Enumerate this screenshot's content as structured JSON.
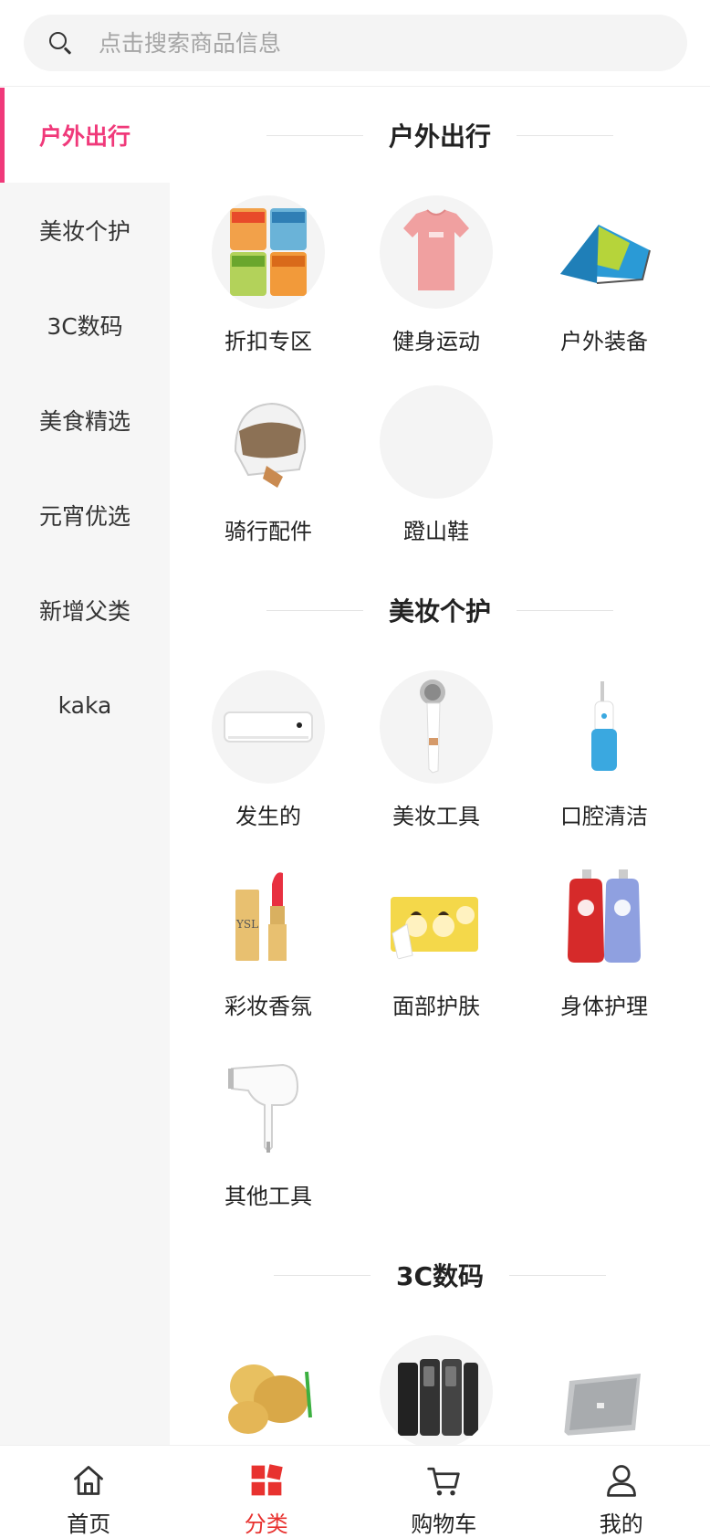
{
  "search": {
    "placeholder": "点击搜索商品信息"
  },
  "sidebar": {
    "items": [
      {
        "label": "户外出行",
        "active": true
      },
      {
        "label": "美妆个护"
      },
      {
        "label": "3C数码"
      },
      {
        "label": "美食精选"
      },
      {
        "label": "元宵优选"
      },
      {
        "label": "新增父类"
      },
      {
        "label": "kaka"
      }
    ]
  },
  "sections": [
    {
      "title": "户外出行",
      "items": [
        {
          "label": "折扣专区",
          "icon": "instant-noodle-cups-image"
        },
        {
          "label": "健身运动",
          "icon": "pink-tshirt-image"
        },
        {
          "label": "户外装备",
          "icon": "tent-image"
        },
        {
          "label": "骑行配件",
          "icon": "helmet-image"
        },
        {
          "label": "蹬山鞋",
          "icon": "empty-image"
        }
      ]
    },
    {
      "title": "美妆个护",
      "items": [
        {
          "label": "发生的",
          "icon": "air-conditioner-image"
        },
        {
          "label": "美妆工具",
          "icon": "face-brush-image"
        },
        {
          "label": "口腔清洁",
          "icon": "water-flosser-image"
        },
        {
          "label": "彩妆香氛",
          "icon": "lipstick-image"
        },
        {
          "label": "面部护肤",
          "icon": "face-mask-image"
        },
        {
          "label": "身体护理",
          "icon": "body-wash-bottles-image"
        },
        {
          "label": "其他工具",
          "icon": "hair-dryer-image"
        }
      ]
    },
    {
      "title": "3C数码",
      "items": [
        {
          "label": "",
          "icon": "potato-image"
        },
        {
          "label": "",
          "icon": "smartphones-image"
        },
        {
          "label": "",
          "icon": "laptop-image"
        }
      ]
    }
  ],
  "tabbar": {
    "items": [
      {
        "label": "首页",
        "icon": "home-icon"
      },
      {
        "label": "分类",
        "icon": "category-icon",
        "active": true
      },
      {
        "label": "购物车",
        "icon": "cart-icon"
      },
      {
        "label": "我的",
        "icon": "user-icon"
      }
    ]
  },
  "colors": {
    "accent": "#f0397a",
    "tab_active": "#e8322f"
  }
}
